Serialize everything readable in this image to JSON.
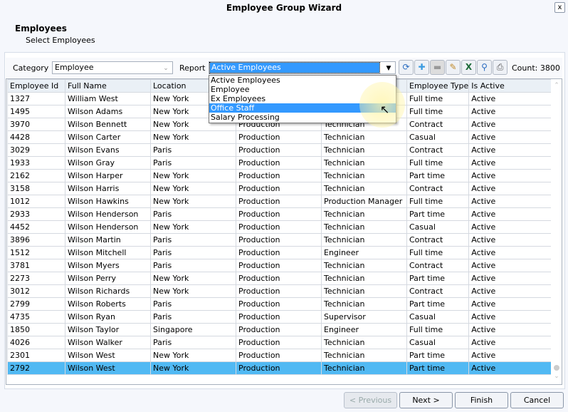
{
  "window": {
    "title": "Employee Group Wizard",
    "close": "x"
  },
  "header": {
    "title": "Employees",
    "subtitle": "Select Employees"
  },
  "filter": {
    "category_label": "Category",
    "category_value": "Employee",
    "report_label": "Report",
    "report_value": "Active Employees",
    "count": "Count: 3800"
  },
  "toolbar": [
    "refresh-icon",
    "add-icon",
    "remove-icon",
    "edit-icon",
    "excel-icon",
    "search-icon",
    "print-icon"
  ],
  "dropdown": {
    "options": [
      "Active Employees",
      "Employee",
      "Ex Employees",
      "Office Staff",
      "Salary Processing"
    ],
    "highlighted": "Office Staff"
  },
  "columns": [
    "Employee Id",
    "Full Name",
    "Location",
    "",
    "",
    "Employee Type",
    "Is Active"
  ],
  "rows": [
    [
      "1327",
      "William West",
      "New York",
      "",
      "",
      "Full time",
      "Active"
    ],
    [
      "1495",
      "Wilson Adams",
      "New York",
      "",
      "",
      "Full time",
      "Active"
    ],
    [
      "3970",
      "Wilson Bennett",
      "New York",
      "Production",
      "Technician",
      "Contract",
      "Active"
    ],
    [
      "4428",
      "Wilson Carter",
      "New York",
      "Production",
      "Technician",
      "Casual",
      "Active"
    ],
    [
      "3029",
      "Wilson Evans",
      "Paris",
      "Production",
      "Technician",
      "Contract",
      "Active"
    ],
    [
      "1933",
      "Wilson Gray",
      "Paris",
      "Production",
      "Technician",
      "Full time",
      "Active"
    ],
    [
      "2162",
      "Wilson Harper",
      "New York",
      "Production",
      "Technician",
      "Part time",
      "Active"
    ],
    [
      "3158",
      "Wilson Harris",
      "New York",
      "Production",
      "Technician",
      "Contract",
      "Active"
    ],
    [
      "1012",
      "Wilson Hawkins",
      "New York",
      "Production",
      "Production Manager",
      "Full time",
      "Active"
    ],
    [
      "2933",
      "Wilson Henderson",
      "Paris",
      "Production",
      "Technician",
      "Part time",
      "Active"
    ],
    [
      "4452",
      "Wilson Henderson",
      "New York",
      "Production",
      "Technician",
      "Casual",
      "Active"
    ],
    [
      "3896",
      "Wilson Martin",
      "Paris",
      "Production",
      "Technician",
      "Contract",
      "Active"
    ],
    [
      "1512",
      "Wilson Mitchell",
      "Paris",
      "Production",
      "Engineer",
      "Full time",
      "Active"
    ],
    [
      "3781",
      "Wilson Myers",
      "Paris",
      "Production",
      "Technician",
      "Contract",
      "Active"
    ],
    [
      "2273",
      "Wilson Perry",
      "New York",
      "Production",
      "Technician",
      "Part time",
      "Active"
    ],
    [
      "3012",
      "Wilson Richards",
      "New York",
      "Production",
      "Technician",
      "Contract",
      "Active"
    ],
    [
      "2799",
      "Wilson Roberts",
      "Paris",
      "Production",
      "Technician",
      "Part time",
      "Active"
    ],
    [
      "4735",
      "Wilson Ryan",
      "Paris",
      "Production",
      "Supervisor",
      "Casual",
      "Active"
    ],
    [
      "1850",
      "Wilson Taylor",
      "Singapore",
      "Production",
      "Engineer",
      "Full time",
      "Active"
    ],
    [
      "4026",
      "Wilson Walker",
      "Paris",
      "Production",
      "Technician",
      "Casual",
      "Active"
    ],
    [
      "2301",
      "Wilson West",
      "New York",
      "Production",
      "Technician",
      "Part time",
      "Active"
    ],
    [
      "2792",
      "Wilson West",
      "New York",
      "Production",
      "Technician",
      "Part time",
      "Active"
    ]
  ],
  "selected_row": 21,
  "buttons": {
    "previous": "< Previous",
    "next": "Next >",
    "finish": "Finish",
    "cancel": "Cancel"
  }
}
